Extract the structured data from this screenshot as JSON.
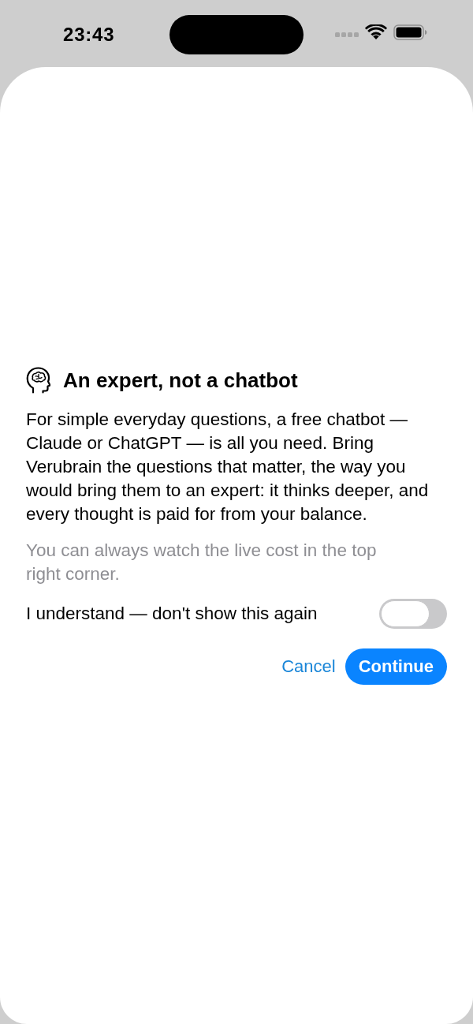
{
  "status_bar": {
    "time": "23:43"
  },
  "dialog": {
    "title": "An expert, not a chatbot",
    "body": "For simple everyday questions, a free chatbot — Claude or ChatGPT — is all you need. Bring Verubrain the questions that matter, the way you would bring them to an expert: it thinks deeper, and every thought is paid for from your balance.",
    "note": "You can always watch the live cost in the top right corner.",
    "toggle": {
      "label": "I understand — don't show this again",
      "on": false
    },
    "buttons": [
      {
        "label": "Cancel",
        "kind": "text"
      },
      {
        "label": "Continue",
        "kind": "filled"
      }
    ]
  }
}
